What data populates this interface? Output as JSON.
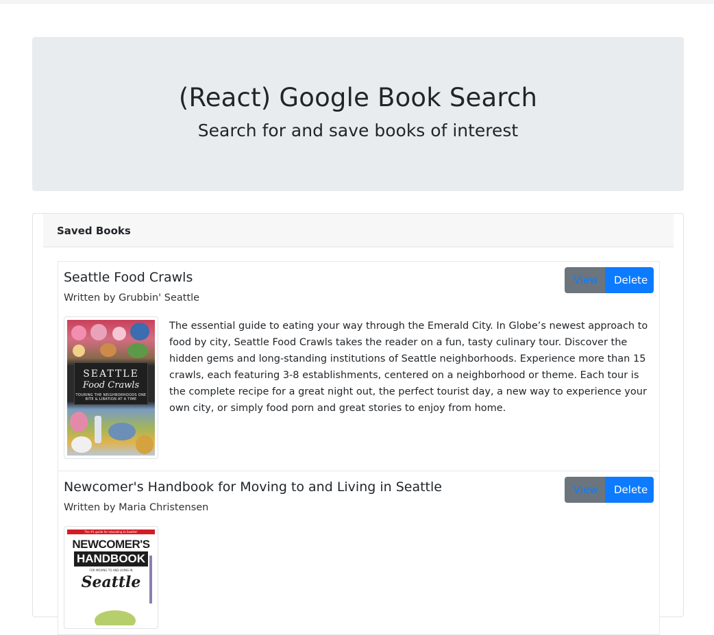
{
  "header": {
    "title": "(React) Google Book Search",
    "subtitle": "Search for and save books of interest"
  },
  "saved": {
    "heading": "Saved Books",
    "books": [
      {
        "title": "Seattle Food Crawls",
        "author": "Written by Grubbin' Seattle",
        "view_label": "View",
        "delete_label": "Delete",
        "description": "The essential guide to eating your way through the Emerald City. In Globe’s newest approach to food by city, Seattle Food Crawls takes the reader on a fun, tasty culinary tour. Discover the hidden gems and long-standing institutions of Seattle neighborhoods. Experience more than 15 crawls, each featuring 3-8 establishments, centered on a neighborhood or theme. Each tour is the complete recipe for a great night out, the perfect tourist day, a new way to experience your own city, or simply food porn and great stories to enjoy from home.",
        "cover": {
          "line1": "SEATTLE",
          "line2": "Food Crawls",
          "line3": "TOURING THE NEIGHBORHOODS ONE BITE & LIBATION AT A TIME"
        }
      },
      {
        "title": "Newcomer's Handbook for Moving to and Living in Seattle",
        "author": "Written by Maria Christensen",
        "view_label": "View",
        "delete_label": "Delete",
        "description": "",
        "cover": {
          "top_banner": "The #1 guide for relocating to Seattle!",
          "line1": "NEWCOMER'S",
          "line2": "HANDBOOK",
          "line3": "FOR MOVING TO AND LIVING IN",
          "line4": "Seattle"
        }
      }
    ]
  },
  "colors": {
    "jumbotron_bg": "#e9ecef",
    "view_btn_bg": "#6c757d",
    "view_btn_text": "#0d7bff",
    "delete_btn_bg": "#0d7bff"
  }
}
